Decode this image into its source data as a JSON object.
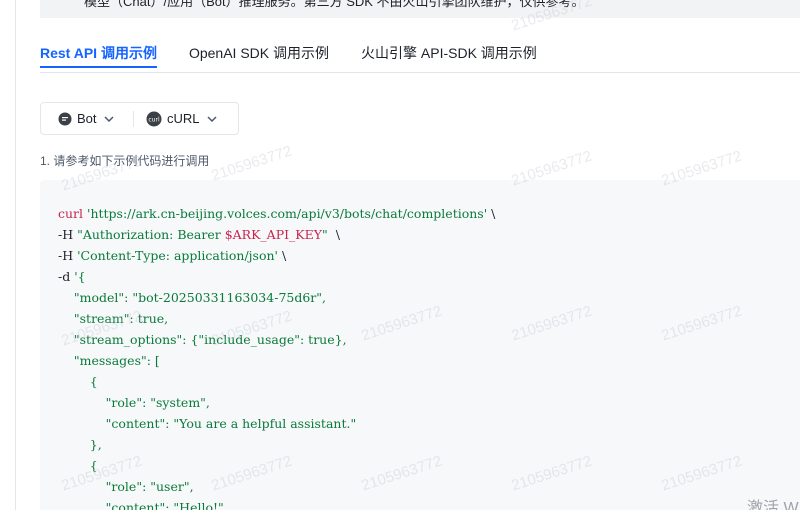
{
  "notice": {
    "text": "模型（Chat）/应用（Bot）推理服务。第三方 SDK 不由火山引擎团队维护，仅供参考。"
  },
  "tabs": [
    {
      "label": "Rest API 调用示例",
      "active": true
    },
    {
      "label": "OpenAI SDK 调用示例",
      "active": false
    },
    {
      "label": "火山引擎 API-SDK 调用示例",
      "active": false
    }
  ],
  "selectors": {
    "type_value": "Bot",
    "type_icon": "chat-bubble-icon",
    "lang_value": "cURL",
    "lang_icon": "curl-logo-icon"
  },
  "hint": "1. 请参考如下示例代码进行调用",
  "code": {
    "cmd": "curl",
    "url": "'https://ark.cn-beijing.volces.com/api/v3/bots/chat/completions'",
    "h_flag1": "-H",
    "auth_str_a": "\"Authorization: Bearer ",
    "auth_var": "$ARK_API_KEY",
    "auth_str_b": "\"",
    "h_flag2": "-H",
    "ctype_str": "'Content-Type: application/json'",
    "d_flag": "-d",
    "d_open": "'{",
    "model_line": "    \"model\": \"bot-20250331163034-75d6r\",",
    "stream_line": "    \"stream\": true,",
    "stream_opts_line": "    \"stream_options\": {\"include_usage\": true},",
    "messages_line": "    \"messages\": [",
    "obj1_open": "        {",
    "role1_line": "            \"role\": \"system\",",
    "content1_line": "            \"content\": \"You are a helpful assistant.\"",
    "obj1_close": "        },",
    "obj2_open": "        {",
    "role2_line": "            \"role\": \"user\",",
    "content2_line": "            \"content\": \"Hello!\""
  },
  "watermark": "2105963772",
  "activate_text": "激活 W"
}
